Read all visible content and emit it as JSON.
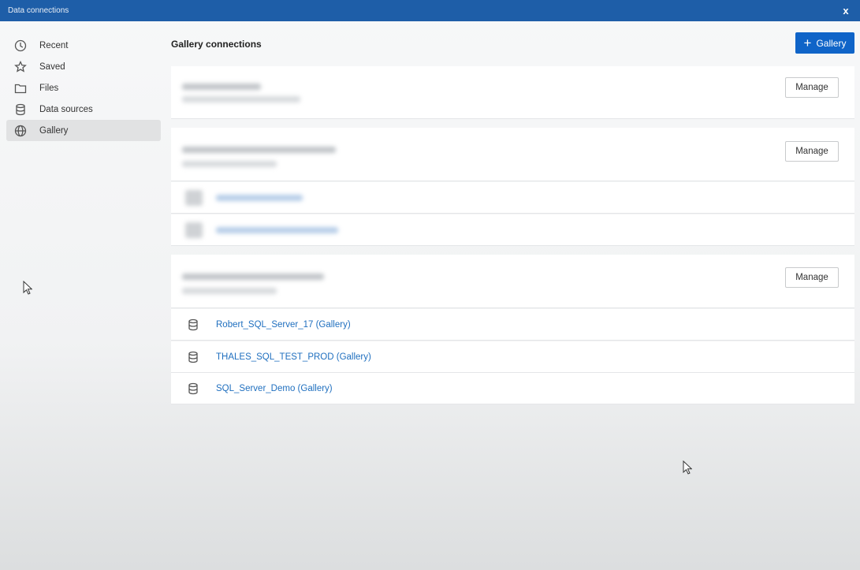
{
  "window": {
    "title": "Data connections",
    "close_label": "x"
  },
  "sidebar": {
    "items": [
      {
        "label": "Recent",
        "icon": "clock-icon"
      },
      {
        "label": "Saved",
        "icon": "star-icon"
      },
      {
        "label": "Files",
        "icon": "folder-icon"
      },
      {
        "label": "Data sources",
        "icon": "database-icon"
      },
      {
        "label": "Gallery",
        "icon": "globe-icon",
        "active": true
      }
    ]
  },
  "main": {
    "title": "Gallery connections",
    "add_button_label": "Gallery",
    "manage_label": "Manage",
    "connections": [
      {
        "label": "Robert_SQL_Server_17 (Gallery)",
        "icon": "database-icon"
      },
      {
        "label": "THALES_SQL_TEST_PROD (Gallery)",
        "icon": "database-icon"
      },
      {
        "label": "SQL_Server_Demo (Gallery)",
        "icon": "database-icon"
      }
    ]
  },
  "colors": {
    "titlebar": "#1e5ea8",
    "accent": "#0f64c8",
    "link": "#1f6fbf"
  }
}
